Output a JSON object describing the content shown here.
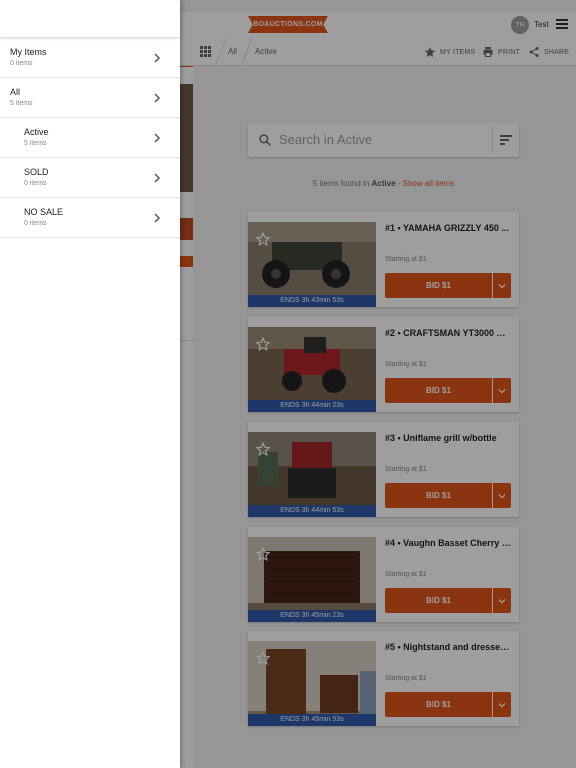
{
  "header": {
    "logo_text": "BOAUCTIONS.COM",
    "user_initials": "TR",
    "user_name": "Test"
  },
  "subbar": {
    "crumb_all": "All",
    "crumb_active": "Active",
    "my_items": "MY ITEMS",
    "print": "PRINT",
    "share": "SHARE"
  },
  "search": {
    "placeholder": "Search in Active"
  },
  "results": {
    "count_text": "5 items found in",
    "filter_name": "Active",
    "separator": " - ",
    "show_all": "Show all items"
  },
  "lots": [
    {
      "title": "#1 • YAMAHA GRIZZLY 450 ...",
      "start": "Starting at $1",
      "bid_label": "BID $1",
      "ends": "ENDS 3h 43min 53s"
    },
    {
      "title": "#2 • CRAFTSMAN YT3000 Ri...",
      "start": "Starting at $1",
      "bid_label": "BID $1",
      "ends": "ENDS 3h 44min 23s"
    },
    {
      "title": "#3 • Uniflame grill w/bottle",
      "start": "Starting at $1",
      "bid_label": "BID $1",
      "ends": "ENDS 3h 44min 53s"
    },
    {
      "title": "#4 • Vaughn Basset Cherry D...",
      "start": "Starting at $1",
      "bid_label": "BID $1",
      "ends": "ENDS 3h 45min 23s"
    },
    {
      "title": "#5 • Nightstand and dresser ...",
      "start": "Starting at $1",
      "bid_label": "BID $1",
      "ends": "ENDS 3h 45min 53s"
    }
  ],
  "drawer": {
    "items": [
      {
        "label": "My Items",
        "count": "0 items"
      },
      {
        "label": "All",
        "count": "5 items"
      },
      {
        "label": "Active",
        "count": "5 items"
      },
      {
        "label": "SOLD",
        "count": "0 items"
      },
      {
        "label": "NO SALE",
        "count": "0 items"
      }
    ]
  },
  "colors": {
    "accent": "#e0541a",
    "ends_bar": "#2e5aa8",
    "scrim": "rgba(0,0,0,0.38)"
  },
  "icons": [
    "menu-icon",
    "grid-icon",
    "star-icon",
    "print-icon",
    "share-icon",
    "search-icon",
    "sort-icon",
    "chevron-right-icon",
    "chevron-down-icon"
  ]
}
